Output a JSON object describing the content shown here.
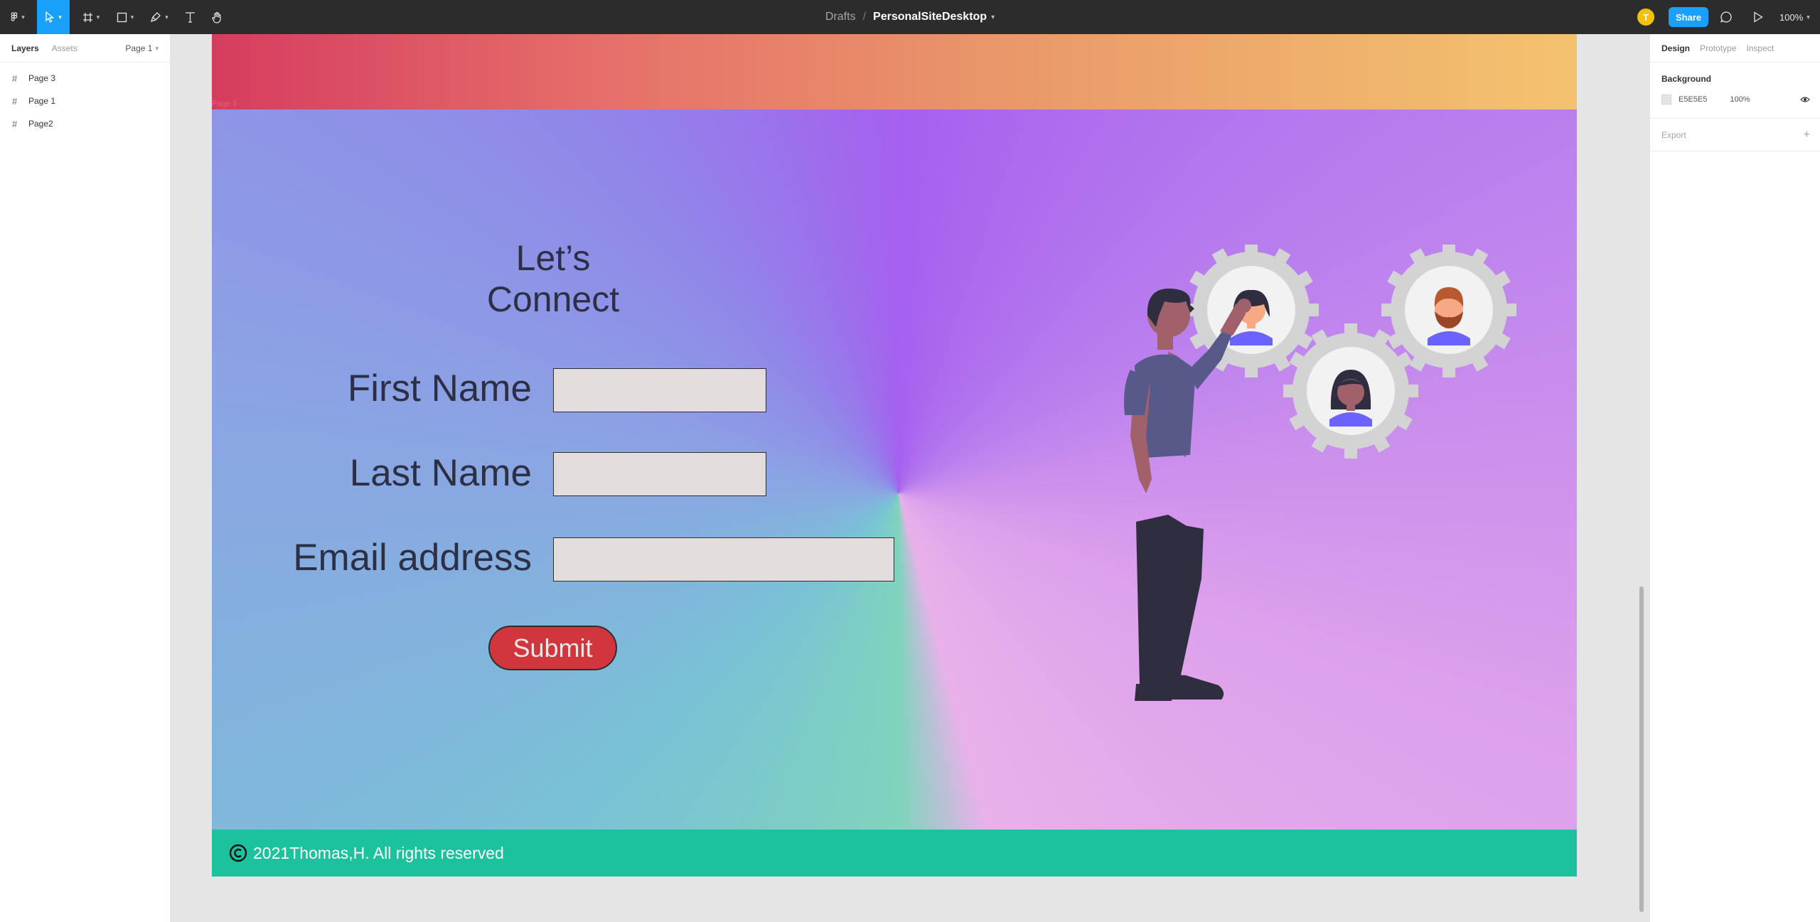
{
  "toolbar": {
    "file_name": "PersonalSiteDesktop",
    "drafts_label": "Drafts",
    "separator": "/",
    "avatar_initial": "T",
    "share_label": "Share",
    "zoom_label": "100%"
  },
  "left_panel": {
    "tabs": [
      "Layers",
      "Assets"
    ],
    "page_selector": "Page 1",
    "layers": [
      "Page 3",
      "Page 1",
      "Page2"
    ]
  },
  "right_panel": {
    "tabs": [
      "Design",
      "Prototype",
      "Inspect"
    ],
    "background_title": "Background",
    "background_hex": "E5E5E5",
    "background_opacity": "100%",
    "export_label": "Export"
  },
  "canvas": {
    "frame_label": "Page 3",
    "title": "Let’s Connect",
    "fields": [
      {
        "label": "First Name"
      },
      {
        "label": "Last Name"
      },
      {
        "label": "Email address"
      }
    ],
    "submit_label": "Submit",
    "footer_text": "2021Thomas,H. All rights reserved"
  },
  "colors": {
    "accent": "#18a0fb",
    "footer": "#1cc29d",
    "submit": "#d0363c",
    "avatar": "#f2c10c"
  }
}
